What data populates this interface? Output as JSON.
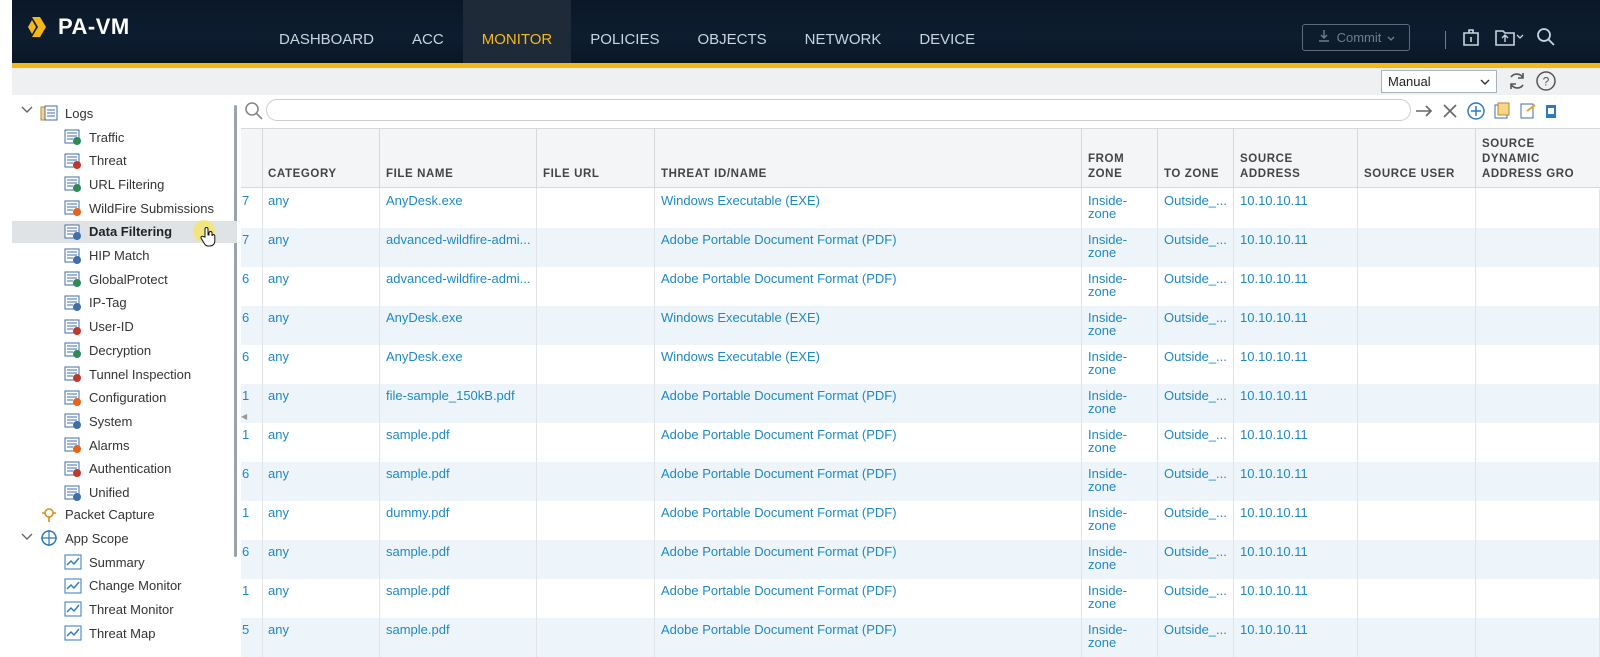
{
  "app": {
    "name": "PA-VM"
  },
  "nav": {
    "items": [
      {
        "label": "DASHBOARD",
        "active": false
      },
      {
        "label": "ACC",
        "active": false
      },
      {
        "label": "MONITOR",
        "active": true
      },
      {
        "label": "POLICIES",
        "active": false
      },
      {
        "label": "OBJECTS",
        "active": false
      },
      {
        "label": "NETWORK",
        "active": false
      },
      {
        "label": "DEVICE",
        "active": false
      }
    ],
    "commit_label": "Commit"
  },
  "toolbar": {
    "refresh_mode": "Manual"
  },
  "colors": {
    "accent": "#f5b819",
    "link": "#1e88c7",
    "header_bg": "#0d1d30"
  },
  "sidebar": {
    "logs_label": "Logs",
    "log_items": [
      {
        "label": "Traffic",
        "icon": "traffic-log-icon"
      },
      {
        "label": "Threat",
        "icon": "threat-log-icon"
      },
      {
        "label": "URL Filtering",
        "icon": "url-filtering-icon"
      },
      {
        "label": "WildFire Submissions",
        "icon": "wildfire-icon"
      },
      {
        "label": "Data Filtering",
        "icon": "data-filtering-icon",
        "selected": true
      },
      {
        "label": "HIP Match",
        "icon": "hip-match-icon"
      },
      {
        "label": "GlobalProtect",
        "icon": "globalprotect-icon"
      },
      {
        "label": "IP-Tag",
        "icon": "ip-tag-icon"
      },
      {
        "label": "User-ID",
        "icon": "user-id-icon"
      },
      {
        "label": "Decryption",
        "icon": "decryption-icon"
      },
      {
        "label": "Tunnel Inspection",
        "icon": "tunnel-inspection-icon"
      },
      {
        "label": "Configuration",
        "icon": "configuration-icon"
      },
      {
        "label": "System",
        "icon": "system-icon"
      },
      {
        "label": "Alarms",
        "icon": "alarms-icon"
      },
      {
        "label": "Authentication",
        "icon": "authentication-icon"
      },
      {
        "label": "Unified",
        "icon": "unified-icon"
      }
    ],
    "packet_capture_label": "Packet Capture",
    "app_scope_label": "App Scope",
    "app_scope_items": [
      {
        "label": "Summary",
        "icon": "summary-icon"
      },
      {
        "label": "Change Monitor",
        "icon": "change-monitor-icon"
      },
      {
        "label": "Threat Monitor",
        "icon": "threat-monitor-icon"
      },
      {
        "label": "Threat Map",
        "icon": "threat-map-icon"
      }
    ]
  },
  "table": {
    "headers": {
      "category": "CATEGORY",
      "file_name": "FILE NAME",
      "file_url": "FILE URL",
      "threat": "THREAT ID/NAME",
      "from_zone_1": "FROM",
      "from_zone_2": "ZONE",
      "to_zone": "TO ZONE",
      "source_address": "SOURCE ADDRESS",
      "source_user": "SOURCE USER",
      "sdag_1": "SOURCE",
      "sdag_2": "DYNAMIC",
      "sdag_3": "ADDRESS GRO"
    },
    "rows": [
      {
        "lead": "7",
        "category": "any",
        "file_name": "AnyDesk.exe",
        "threat": "Windows Executable (EXE)",
        "from_zone_1": "Inside-",
        "from_zone_2": "zone",
        "to_zone": "Outside_...",
        "source_address": "10.10.10.11"
      },
      {
        "lead": "7",
        "category": "any",
        "file_name": "advanced-wildfire-admi...",
        "threat": "Adobe Portable Document Format (PDF)",
        "from_zone_1": "Inside-",
        "from_zone_2": "zone",
        "to_zone": "Outside_...",
        "source_address": "10.10.10.11"
      },
      {
        "lead": "6",
        "category": "any",
        "file_name": "advanced-wildfire-admi...",
        "threat": "Adobe Portable Document Format (PDF)",
        "from_zone_1": "Inside-",
        "from_zone_2": "zone",
        "to_zone": "Outside_...",
        "source_address": "10.10.10.11"
      },
      {
        "lead": "6",
        "category": "any",
        "file_name": "AnyDesk.exe",
        "threat": "Windows Executable (EXE)",
        "from_zone_1": "Inside-",
        "from_zone_2": "zone",
        "to_zone": "Outside_...",
        "source_address": "10.10.10.11"
      },
      {
        "lead": "6",
        "category": "any",
        "file_name": "AnyDesk.exe",
        "threat": "Windows Executable (EXE)",
        "from_zone_1": "Inside-",
        "from_zone_2": "zone",
        "to_zone": "Outside_...",
        "source_address": "10.10.10.11"
      },
      {
        "lead": "1",
        "category": "any",
        "file_name": "file-sample_150kB.pdf",
        "threat": "Adobe Portable Document Format (PDF)",
        "from_zone_1": "Inside-",
        "from_zone_2": "zone",
        "to_zone": "Outside_...",
        "source_address": "10.10.10.11"
      },
      {
        "lead": "1",
        "category": "any",
        "file_name": "sample.pdf",
        "threat": "Adobe Portable Document Format (PDF)",
        "from_zone_1": "Inside-",
        "from_zone_2": "zone",
        "to_zone": "Outside_...",
        "source_address": "10.10.10.11"
      },
      {
        "lead": "6",
        "category": "any",
        "file_name": "sample.pdf",
        "threat": "Adobe Portable Document Format (PDF)",
        "from_zone_1": "Inside-",
        "from_zone_2": "zone",
        "to_zone": "Outside_...",
        "source_address": "10.10.10.11"
      },
      {
        "lead": "1",
        "category": "any",
        "file_name": "dummy.pdf",
        "threat": "Adobe Portable Document Format (PDF)",
        "from_zone_1": "Inside-",
        "from_zone_2": "zone",
        "to_zone": "Outside_...",
        "source_address": "10.10.10.11"
      },
      {
        "lead": "6",
        "category": "any",
        "file_name": "sample.pdf",
        "threat": "Adobe Portable Document Format (PDF)",
        "from_zone_1": "Inside-",
        "from_zone_2": "zone",
        "to_zone": "Outside_...",
        "source_address": "10.10.10.11"
      },
      {
        "lead": "1",
        "category": "any",
        "file_name": "sample.pdf",
        "threat": "Adobe Portable Document Format (PDF)",
        "from_zone_1": "Inside-",
        "from_zone_2": "zone",
        "to_zone": "Outside_...",
        "source_address": "10.10.10.11"
      },
      {
        "lead": "5",
        "category": "any",
        "file_name": "sample.pdf",
        "threat": "Adobe Portable Document Format (PDF)",
        "from_zone_1": "Inside-",
        "from_zone_2": "zone",
        "to_zone": "Outside_...",
        "source_address": "10.10.10.11"
      }
    ]
  }
}
